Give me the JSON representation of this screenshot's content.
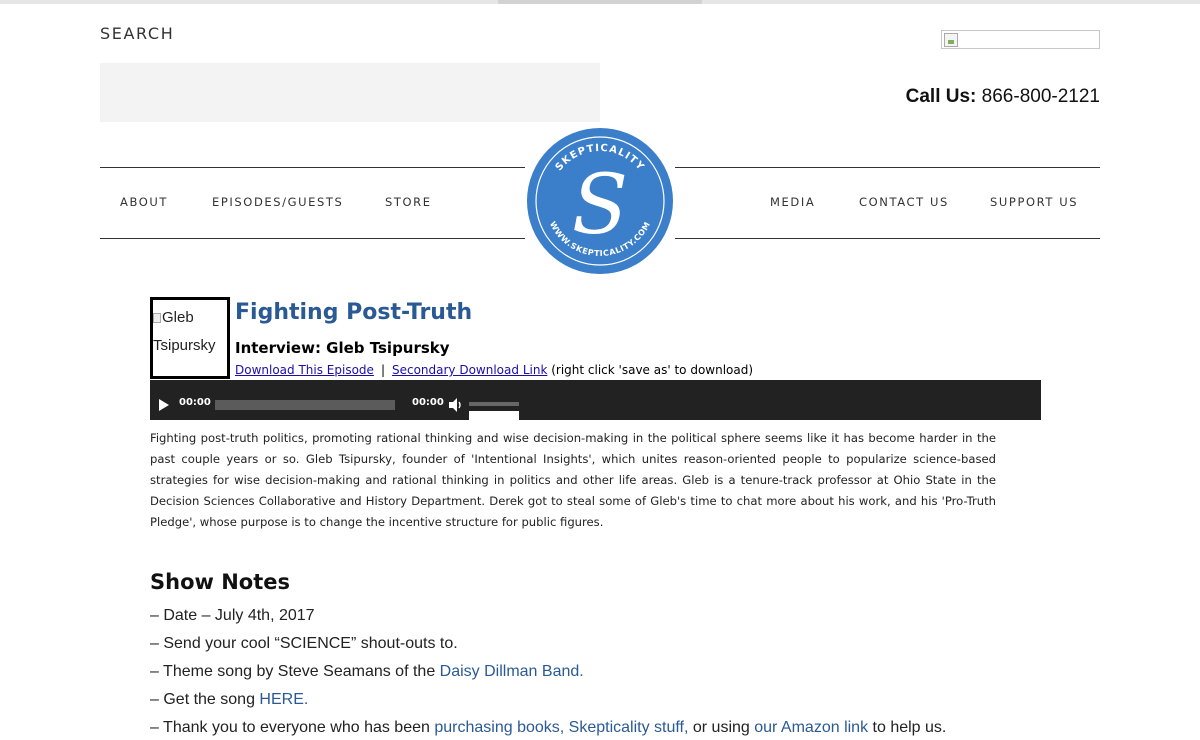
{
  "header": {
    "search_label": "SEARCH",
    "search_placeholder": "",
    "call_label": "Call Us:",
    "phone": "866-800-2121"
  },
  "nav": {
    "left": [
      "ABOUT",
      "EPISODES/GUESTS",
      "STORE"
    ],
    "right": [
      "MEDIA",
      "CONTACT US",
      "SUPPORT US"
    ]
  },
  "logo": {
    "top_text": "SKEPTICALITY",
    "bottom_text": "WWW.SKEPTICALITY.COM",
    "letter": "S",
    "color": "#3b7ec9"
  },
  "episode": {
    "image_alt": "Gleb Tsipursky",
    "title": "Fighting Post-Truth",
    "subtitle": "Interview: Gleb Tsipursky",
    "download_link": "Download This Episode",
    "separator": "|",
    "secondary_link": "Secondary Download Link",
    "download_note": "(right click 'save as' to download)"
  },
  "player": {
    "current_time": "00:00",
    "duration": "00:00",
    "volume": 1.0
  },
  "description": "Fighting post-truth politics, promoting rational thinking and wise decision-making in the political sphere seems like it has become harder in the past couple years or so. Gleb Tsipursky, founder of 'Intentional Insights', which unites reason-oriented people to popularize science-based strategies for wise decision-making and rational thinking in politics and other life areas. Gleb is a tenure-track professor at Ohio State in the Decision Sciences Collaborative and History Department. Derek got to steal some of Gleb's time to chat more about his work, and his 'Pro-Truth Pledge', whose purpose is to change the incentive structure for public figures.",
  "show_notes": {
    "heading": "Show Notes",
    "date": "– Date – July 4th, 2017",
    "shoutouts": "– Send your cool “SCIENCE” shout-outs to.",
    "theme_prefix": "– Theme song by Steve Seamans of the ",
    "theme_link": "Daisy Dillman Band.",
    "song_prefix": "– Get the song ",
    "song_link": "HERE.",
    "thanks_prefix": "– Thank you to everyone who has been ",
    "thanks_link1": "purchasing books,",
    "thanks_link2": "Skepticality stuff,",
    "thanks_mid": " or using ",
    "thanks_link3": "our Amazon link",
    "thanks_suffix": " to help us."
  },
  "colors": {
    "link": "#2a5a94",
    "title": "#2a5a94",
    "player_bg": "#222222"
  }
}
